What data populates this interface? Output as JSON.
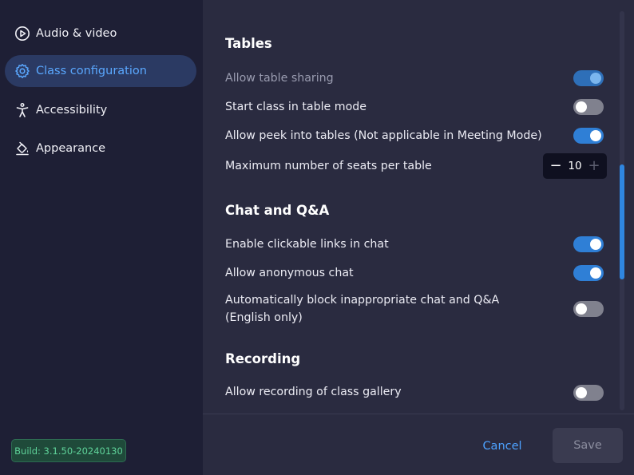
{
  "sidebar": {
    "items": [
      {
        "label": "Audio & video",
        "icon": "play-circle-icon",
        "active": false
      },
      {
        "label": "Class configuration",
        "icon": "gear-icon",
        "active": true
      },
      {
        "label": "Accessibility",
        "icon": "accessibility-person-icon",
        "active": false
      },
      {
        "label": "Appearance",
        "icon": "paint-bucket-icon",
        "active": false
      }
    ],
    "build": "Build: 3.1.50-20240130"
  },
  "sections": {
    "tables": {
      "title": "Tables",
      "allow_table_sharing": {
        "label": "Allow table sharing",
        "on": true,
        "disabled": true
      },
      "start_in_table_mode": {
        "label": "Start class in table mode",
        "on": false
      },
      "allow_peek": {
        "label": "Allow peek into tables (Not applicable in Meeting Mode)",
        "on": true
      },
      "max_seats": {
        "label": "Maximum number of seats per table",
        "value": "10",
        "minus": "−",
        "plus": "+"
      }
    },
    "chat": {
      "title": "Chat and Q&A",
      "clickable_links": {
        "label": "Enable clickable links in chat",
        "on": true
      },
      "anonymous_chat": {
        "label": "Allow anonymous chat",
        "on": true
      },
      "block_inappropriate": {
        "label": "Automatically block inappropriate chat and Q&A (English only)",
        "on": false
      }
    },
    "recording": {
      "title": "Recording",
      "allow_recording_gallery": {
        "label": "Allow recording of class gallery",
        "on": false
      }
    }
  },
  "footer": {
    "cancel_label": "Cancel",
    "save_label": "Save"
  },
  "colors": {
    "accent": "#2f7fd6",
    "background": "#2a2b40",
    "sidebar": "#1e1f35",
    "build_text": "#5fd39a"
  }
}
